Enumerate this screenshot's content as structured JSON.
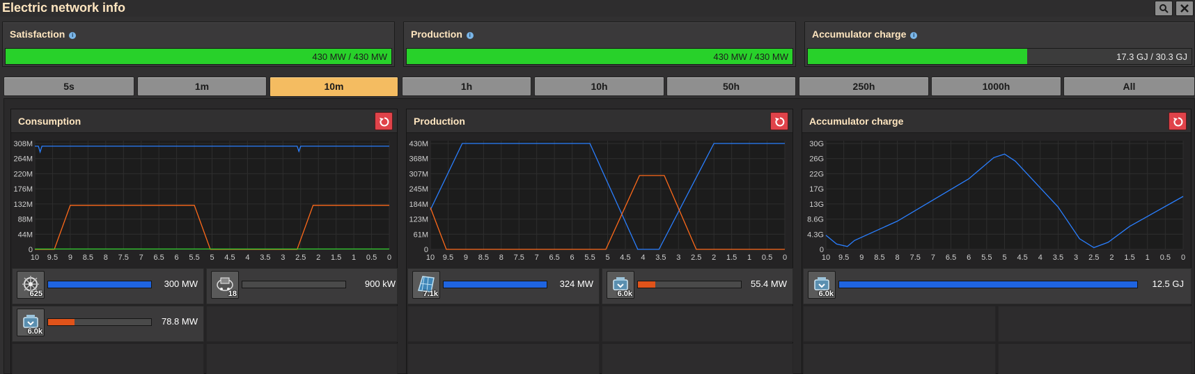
{
  "window": {
    "title": "Electric network info"
  },
  "stats": {
    "satisfaction": {
      "label": "Satisfaction",
      "value": "430 MW / 430 MW",
      "fill": 1.0
    },
    "production": {
      "label": "Production",
      "value": "430 MW / 430 MW",
      "fill": 1.0
    },
    "accumulator": {
      "label": "Accumulator charge",
      "value": "17.3 GJ / 30.3 GJ",
      "fill": 0.571
    }
  },
  "time_tabs": [
    "5s",
    "1m",
    "10m",
    "1h",
    "10h",
    "50h",
    "250h",
    "1000h",
    "All"
  ],
  "active_tab": "10m",
  "panels": {
    "consumption": {
      "title": "Consumption",
      "entries": [
        {
          "icon": "electric-mining-drill-icon",
          "count": "625",
          "value": "300 MW",
          "fill": 1.0,
          "color": "#1f64e0"
        },
        {
          "icon": "inserter-icon",
          "count": "18",
          "value": "900 kW",
          "fill": 0.0,
          "color": "#1f64e0"
        },
        {
          "icon": "accumulator-icon",
          "count": "6.0k",
          "value": "78.8 MW",
          "fill": 0.26,
          "color": "#e0531a"
        }
      ]
    },
    "production": {
      "title": "Production",
      "entries": [
        {
          "icon": "solar-panel-icon",
          "count": "7.1k",
          "value": "324 MW",
          "fill": 1.0,
          "color": "#1f64e0"
        },
        {
          "icon": "accumulator-icon",
          "count": "6.0k",
          "value": "55.4 MW",
          "fill": 0.17,
          "color": "#e0531a"
        }
      ]
    },
    "accumulator": {
      "title": "Accumulator charge",
      "entries": [
        {
          "icon": "accumulator-icon",
          "count": "6.0k",
          "value": "12.5 GJ",
          "fill": 1.0,
          "color": "#1f64e0"
        }
      ]
    }
  },
  "colors": {
    "series_blue": "#2a7fff",
    "series_orange": "#ff6a1a",
    "series_green": "#33d12f",
    "accent_green": "#28d12a",
    "tab_active": "#f4bc61"
  },
  "chart_data": [
    {
      "type": "line",
      "title": "Consumption",
      "x_ticks": [
        "10",
        "9.5",
        "9",
        "8.5",
        "8",
        "7.5",
        "7",
        "6.5",
        "6",
        "5.5",
        "5",
        "4.5",
        "4",
        "3.5",
        "3",
        "2.5",
        "2",
        "1.5",
        "1",
        "0.5",
        "0"
      ],
      "y_ticks": [
        "0",
        "44M",
        "88M",
        "132M",
        "176M",
        "220M",
        "264M",
        "308M"
      ],
      "ylim": [
        0,
        308
      ],
      "series": [
        {
          "color": "#2a7fff",
          "x": [
            10,
            9.9,
            9.85,
            9.8,
            9.7,
            7.5,
            2.7,
            2.6,
            2.55,
            2.5,
            2.4,
            0
          ],
          "y": [
            300,
            300,
            283,
            300,
            300,
            300,
            300,
            300,
            285,
            300,
            300,
            300
          ]
        },
        {
          "color": "#ff6a1a",
          "x": [
            10,
            9.45,
            9.0,
            5.5,
            5.05,
            2.6,
            2.15,
            0
          ],
          "y": [
            0,
            0,
            128,
            128,
            0,
            0,
            128,
            128
          ]
        },
        {
          "color": "#33d12f",
          "x": [
            10,
            0
          ],
          "y": [
            1,
            1
          ]
        }
      ]
    },
    {
      "type": "line",
      "title": "Production",
      "x_ticks": [
        "10",
        "9.5",
        "9",
        "8.5",
        "8",
        "7.5",
        "7",
        "6.5",
        "6",
        "5.5",
        "5",
        "4.5",
        "4",
        "3.5",
        "3",
        "2.5",
        "2",
        "1.5",
        "1",
        "0.5",
        "0"
      ],
      "y_ticks": [
        "0",
        "61M",
        "123M",
        "184M",
        "245M",
        "307M",
        "368M",
        "430M"
      ],
      "ylim": [
        0,
        430
      ],
      "series": [
        {
          "color": "#2a7fff",
          "x": [
            10,
            9.1,
            5.5,
            4.15,
            3.55,
            2.0,
            0
          ],
          "y": [
            160,
            430,
            430,
            0,
            0,
            430,
            430
          ]
        },
        {
          "color": "#ff6a1a",
          "x": [
            10,
            9.55,
            5.05,
            4.1,
            3.4,
            2.5,
            0
          ],
          "y": [
            170,
            0,
            0,
            300,
            300,
            0,
            0
          ]
        }
      ]
    },
    {
      "type": "line",
      "title": "Accumulator charge",
      "x_ticks": [
        "10",
        "9.5",
        "9",
        "8.5",
        "8",
        "7.5",
        "7",
        "6.5",
        "6",
        "5.5",
        "5",
        "4.5",
        "4",
        "3.5",
        "3",
        "2.5",
        "2",
        "1.5",
        "1",
        "0.5",
        "0"
      ],
      "y_ticks": [
        "0",
        "4.3G",
        "8.6G",
        "13G",
        "17G",
        "22G",
        "26G",
        "30G"
      ],
      "ylim": [
        0,
        30
      ],
      "series": [
        {
          "color": "#2a7fff",
          "x": [
            10,
            9.7,
            9.4,
            9.2,
            8.0,
            6.0,
            5.3,
            5.0,
            4.7,
            3.5,
            2.9,
            2.5,
            2.1,
            1.5,
            0
          ],
          "y": [
            4,
            1.5,
            0.8,
            2.5,
            8,
            20,
            26,
            27,
            25,
            12,
            3,
            0.5,
            2,
            6.5,
            15
          ]
        }
      ]
    }
  ]
}
